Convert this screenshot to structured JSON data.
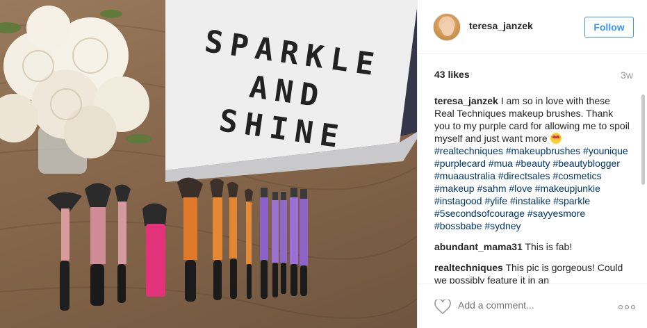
{
  "photo": {
    "lightbox_lines": [
      "SPARKLE",
      "AND",
      "SHINE"
    ]
  },
  "header": {
    "username": "teresa_janzek",
    "follow_label": "Follow"
  },
  "stats": {
    "likes": "43 likes",
    "age": "3w"
  },
  "caption": {
    "user": "teresa_janzek",
    "text": "I am so in love with these Real Techniques makeup brushes. Thank you to my purple card for allowing me to spoil myself and just want more",
    "emoji": "heart-eyes-emoji",
    "hashtags": "#realtechniques #makeupbrushes #younique #purplecard #mua #beauty #beautyblogger #muaaustralia #directsales #cosmetics #makeup #sahm #love #makeupjunkie #instagood #ylife #instalike #sparkle #5secondsofcourage #sayyesmore #bossbabe #sydney"
  },
  "comments": [
    {
      "user": "abundant_mama31",
      "text": "This is fab!"
    },
    {
      "user": "realtechniques",
      "text": "This pic is gorgeous! Could we possibly feature it in an"
    }
  ],
  "footer": {
    "comment_placeholder": "Add a comment...",
    "icons": [
      "heart-icon",
      "more-options-icon"
    ]
  }
}
